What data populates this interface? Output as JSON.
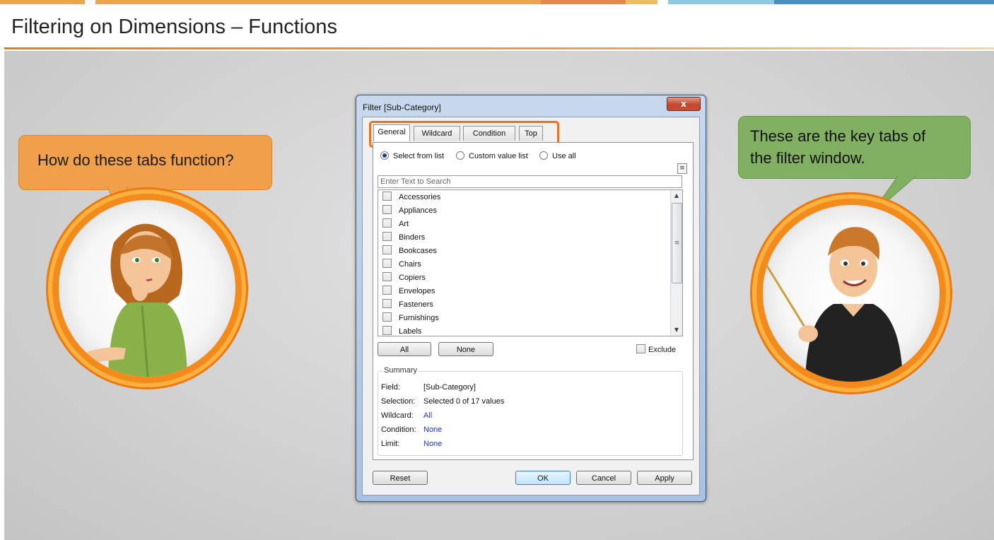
{
  "header": {
    "title": "Filtering on Dimensions – Functions"
  },
  "colors": {
    "accent_orange": "#f38a1c",
    "bubble_orange": "#f0a04a",
    "bubble_green": "#82b062",
    "highlight": "#e2742a"
  },
  "left_character": {
    "speech": "How do these tabs function?"
  },
  "right_character": {
    "speech_line1": "These are the key tabs of",
    "speech_line2": "the filter window."
  },
  "dialog": {
    "title": "Filter [Sub-Category]",
    "close_icon": "x-icon",
    "close_glyph": "x",
    "tabs": [
      "General",
      "Wildcard",
      "Condition",
      "Top"
    ],
    "active_tab": "General",
    "radios": {
      "select_from_list": "Select from list",
      "custom_value_list": "Custom value list",
      "use_all": "Use all"
    },
    "menu_glyph": "≡",
    "search_placeholder": "Enter Text to Search",
    "items": [
      "Accessories",
      "Appliances",
      "Art",
      "Binders",
      "Bookcases",
      "Chairs",
      "Copiers",
      "Envelopes",
      "Fasteners",
      "Furnishings",
      "Labels"
    ],
    "scroll_up": "▲",
    "scroll_down": "▼",
    "scroll_grip": "≡",
    "all_button": "All",
    "none_button": "None",
    "exclude_label": "Exclude",
    "summary": {
      "legend": "Summary",
      "field_label": "Field:",
      "field_value": "[Sub-Category]",
      "selection_label": "Selection:",
      "selection_value": "Selected 0 of 17 values",
      "wildcard_label": "Wildcard:",
      "wildcard_value": "All",
      "condition_label": "Condition:",
      "condition_value": "None",
      "limit_label": "Limit:",
      "limit_value": "None"
    },
    "reset_button": "Reset",
    "ok_button": "OK",
    "cancel_button": "Cancel",
    "apply_button": "Apply"
  }
}
